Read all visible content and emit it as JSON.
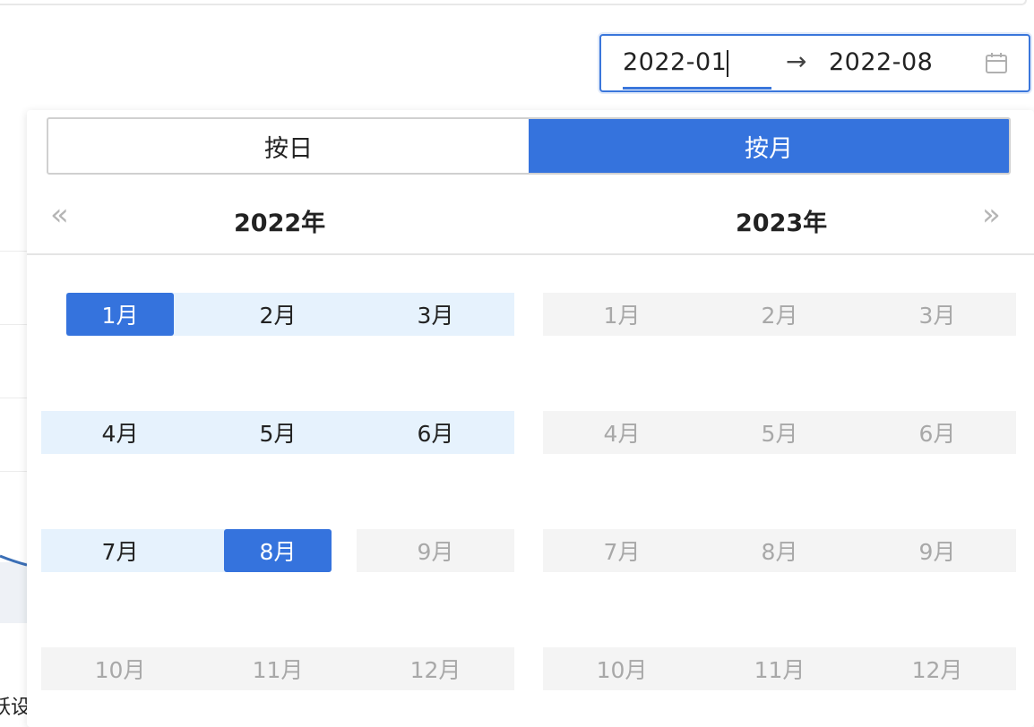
{
  "range": {
    "start": "2022-01",
    "separator": "→",
    "end": "2022-08",
    "icon": "calendar-icon"
  },
  "panel": {
    "toggle": {
      "day": "按日",
      "month": "按月",
      "active": "month"
    },
    "nav": {
      "prev": "«",
      "next": "»"
    },
    "left": {
      "year": "2022年",
      "months": [
        {
          "label": "1月",
          "state": "selected-start"
        },
        {
          "label": "2月",
          "state": "in-range"
        },
        {
          "label": "3月",
          "state": "in-range"
        },
        {
          "label": "4月",
          "state": "in-range"
        },
        {
          "label": "5月",
          "state": "in-range"
        },
        {
          "label": "6月",
          "state": "in-range"
        },
        {
          "label": "7月",
          "state": "in-range"
        },
        {
          "label": "8月",
          "state": "selected-end"
        },
        {
          "label": "9月",
          "state": "disabled"
        },
        {
          "label": "10月",
          "state": "disabled"
        },
        {
          "label": "11月",
          "state": "disabled"
        },
        {
          "label": "12月",
          "state": "disabled"
        }
      ]
    },
    "right": {
      "year": "2023年",
      "months": [
        {
          "label": "1月",
          "state": "disabled"
        },
        {
          "label": "2月",
          "state": "disabled"
        },
        {
          "label": "3月",
          "state": "disabled"
        },
        {
          "label": "4月",
          "state": "disabled"
        },
        {
          "label": "5月",
          "state": "disabled"
        },
        {
          "label": "6月",
          "state": "disabled"
        },
        {
          "label": "7月",
          "state": "disabled"
        },
        {
          "label": "8月",
          "state": "disabled"
        },
        {
          "label": "9月",
          "state": "disabled"
        },
        {
          "label": "10月",
          "state": "disabled"
        },
        {
          "label": "11月",
          "state": "disabled"
        },
        {
          "label": "12月",
          "state": "disabled"
        }
      ]
    }
  },
  "background": {
    "fragment_text": "跃设"
  },
  "colors": {
    "accent": "#3573dd",
    "range_bg": "#e6f2fd",
    "disabled_bg": "#f4f4f4",
    "disabled_text": "#a8a8a8"
  }
}
